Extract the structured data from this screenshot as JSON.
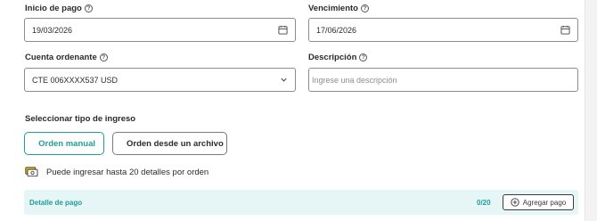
{
  "form": {
    "start_date": {
      "label": "Inicio de pago",
      "help": "?",
      "value": "19/03/2026"
    },
    "due_date": {
      "label": "Vencimiento",
      "help": "?",
      "value": "17/06/2026"
    },
    "account": {
      "label": "Cuenta ordenante",
      "help": "?",
      "value": "CTE 006XXXX537 USD"
    },
    "description": {
      "label": "Descripción",
      "help": "?",
      "value": "",
      "placeholder": "Ingrese una descripción"
    }
  },
  "income_type": {
    "title": "Seleccionar tipo de ingreso",
    "manual_label": "Orden manual",
    "file_label": "Orden desde un archivo",
    "selected": "Orden manual"
  },
  "info_text": "Puede ingresar hasta 20 detalles por orden",
  "payment_detail": {
    "title": "Detalle de pago",
    "count": "0/20",
    "add_label": "Agregar pago"
  },
  "icons": {
    "help": "help-circle-icon",
    "calendar": "calendar-icon",
    "dropdown": "chevron-down-icon",
    "manual": "document-outline-icon",
    "file": "file-icon",
    "info": "card-money-icon",
    "add": "plus-circle-icon"
  },
  "colors": {
    "accent": "#1f9e97",
    "bar_background": "#e6f5f5",
    "info_icon_yellow": "#e8b400"
  }
}
